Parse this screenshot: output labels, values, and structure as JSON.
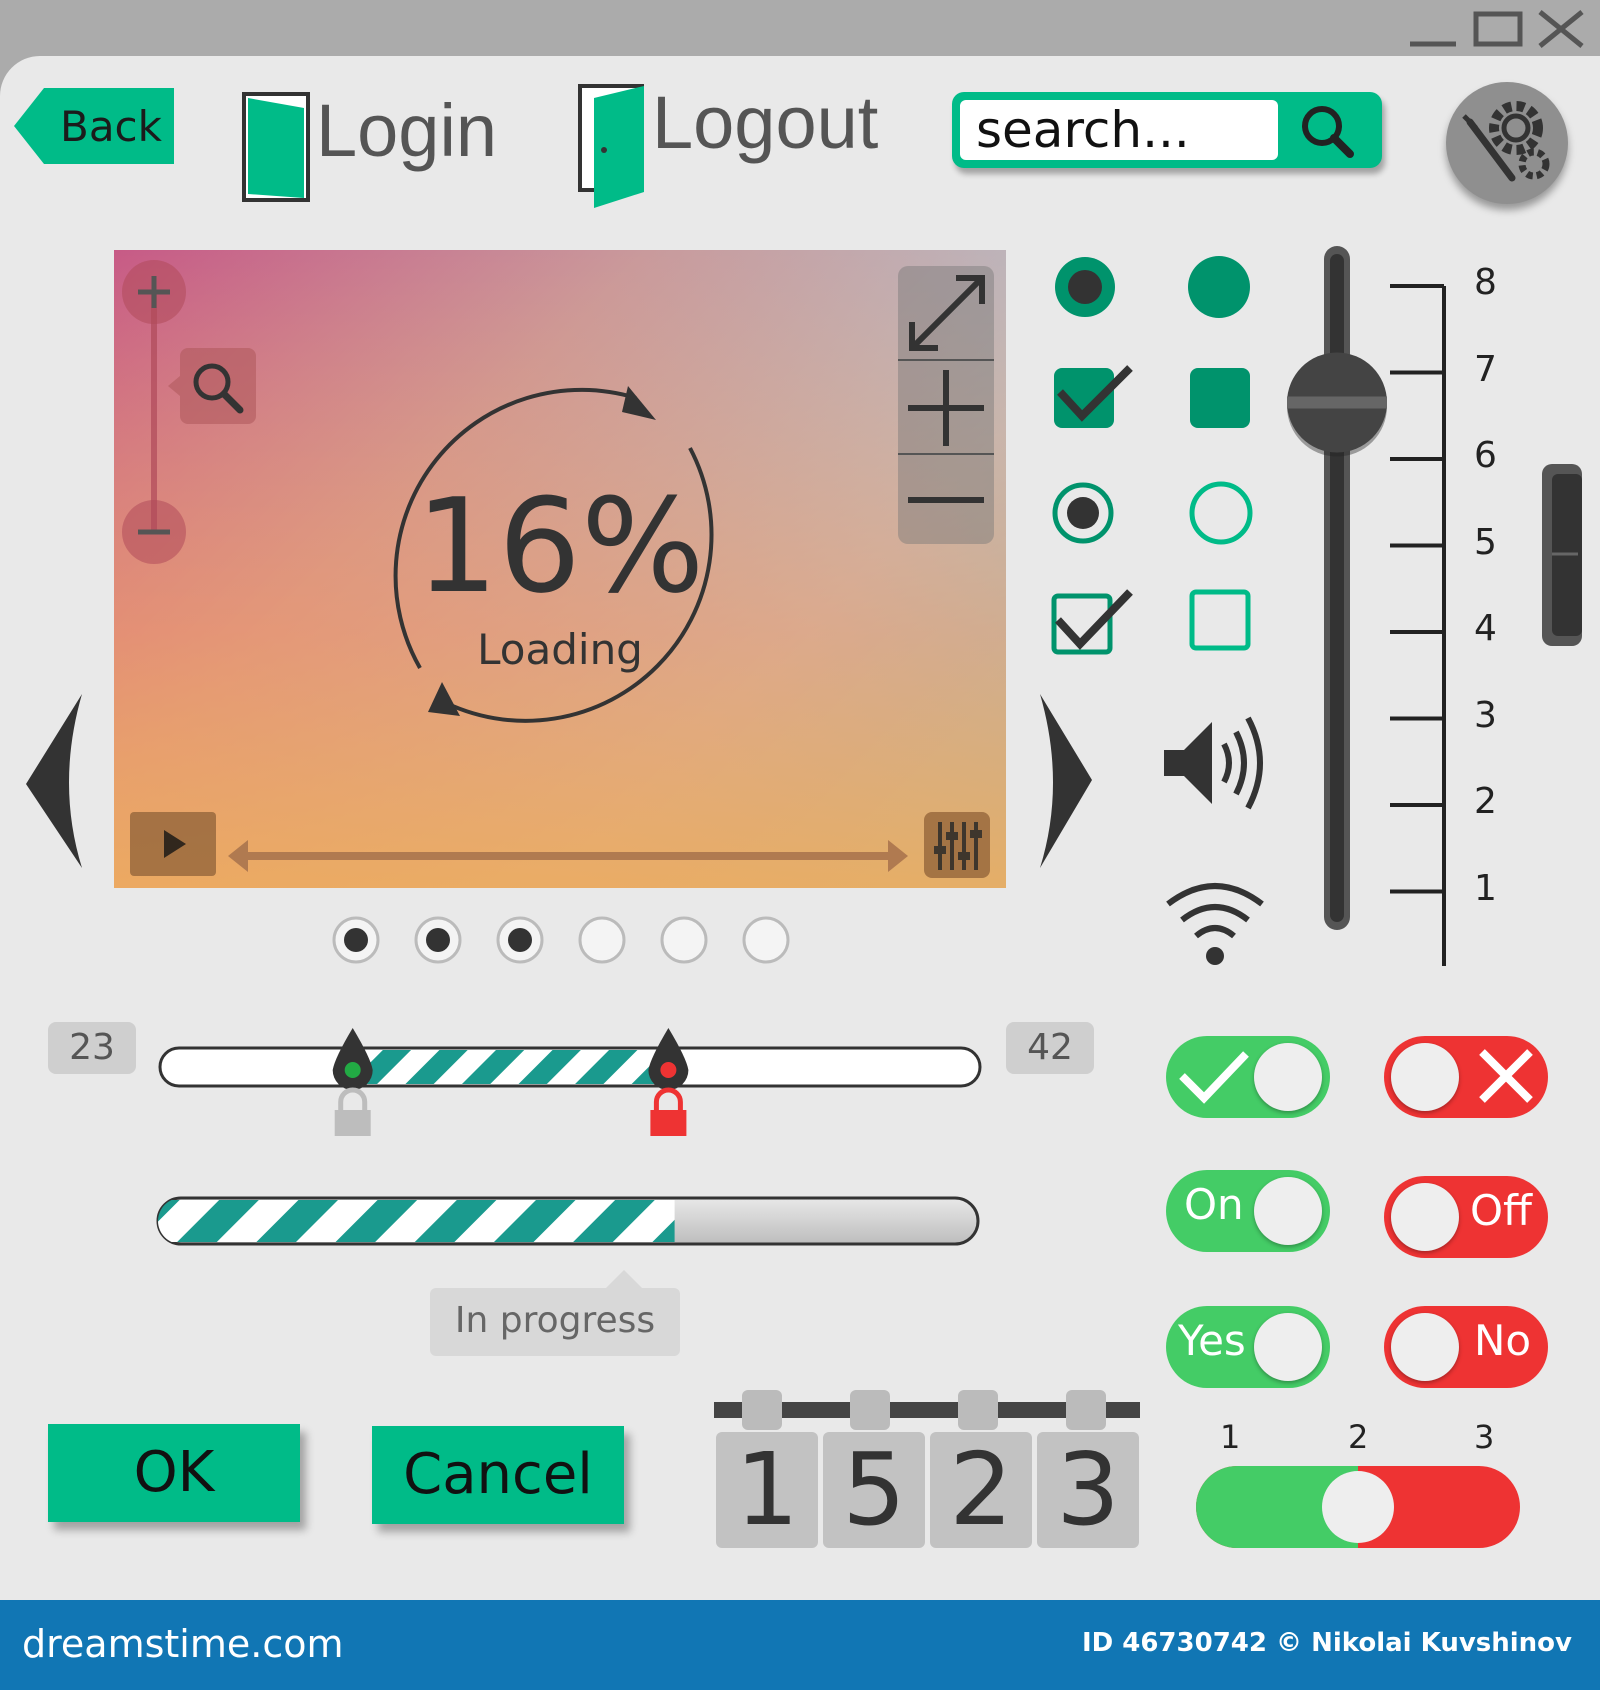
{
  "window": {
    "minimize_icon": "minimize-icon",
    "maximize_icon": "maximize-icon",
    "close_icon": "close-icon"
  },
  "header": {
    "back_label": "Back",
    "login_label": "Login",
    "logout_label": "Logout",
    "search": {
      "value": "search...",
      "icon": "search-icon"
    },
    "settings_icon": "gear-wrench-icon"
  },
  "media": {
    "percent_text": "16%",
    "percent": 16,
    "status": "Loading",
    "icons": [
      "zoom-in-icon",
      "zoom-out-icon",
      "magnifier-icon",
      "fullscreen-icon",
      "plus-icon",
      "minus-icon",
      "play-icon",
      "equalizer-icon"
    ],
    "carousel_total": 6,
    "carousel_filled": 3
  },
  "range_slider": {
    "min_label": "23",
    "max_label": "42",
    "low": 0.235,
    "high": 0.62
  },
  "progress": {
    "value": 0.63,
    "label": "In progress"
  },
  "buttons": {
    "ok": "OK",
    "cancel": "Cancel"
  },
  "counter": {
    "digits": [
      "1",
      "5",
      "2",
      "3"
    ]
  },
  "scale": {
    "labels": [
      "8",
      "7",
      "6",
      "5",
      "4",
      "3",
      "2",
      "1"
    ],
    "value": 7
  },
  "toggles": {
    "on_label": "On",
    "off_label": "Off",
    "yes_label": "Yes",
    "no_label": "No"
  },
  "three_state": {
    "labels": [
      "1",
      "2",
      "3"
    ],
    "value": 2
  },
  "colors": {
    "accent": "#00bb88",
    "green": "#44cc66",
    "red": "#ee3333",
    "footer": "#1176b4"
  },
  "footer": {
    "site": "dreamstime.com",
    "credit": "ID 46730742 © Nikolai Kuvshinov"
  }
}
